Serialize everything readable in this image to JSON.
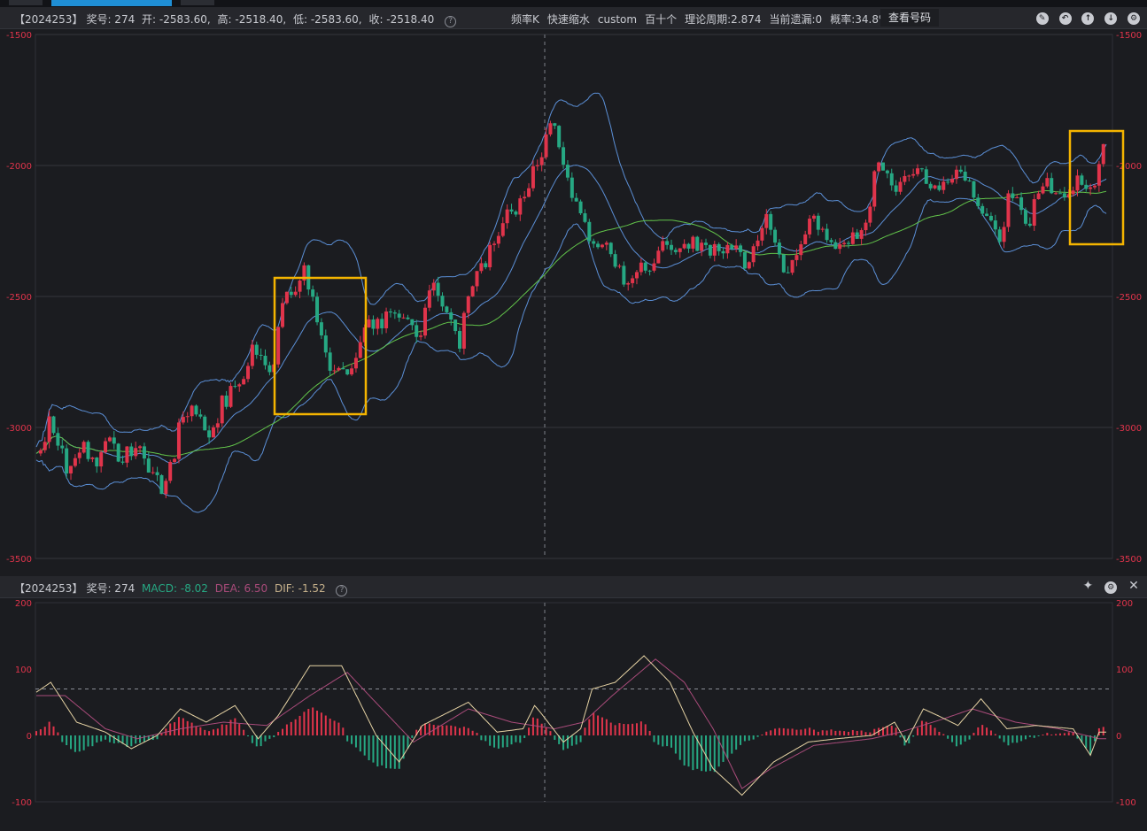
{
  "window": {
    "tabs": [
      "",
      "",
      ""
    ]
  },
  "main_header": {
    "issue": "【2024253】",
    "award_label": "奖号: 274",
    "open_text": "开: -2583.60,",
    "high_text": "高: -2518.40,",
    "low_text": "低: -2583.60,",
    "close_text": "收: -2518.40",
    "items": [
      "频率K",
      "快速缩水",
      "custom",
      "百十个",
      "理论周期:2.874",
      "当前遗漏:0",
      "概率:34.8%"
    ],
    "check_button": "查看号码",
    "icons": [
      "pencil-icon",
      "undo-icon",
      "arrow-up-icon",
      "arrow-down-icon",
      "settings-icon"
    ]
  },
  "sub_header": {
    "issue": "【2024253】",
    "award_label": "奖号: 274",
    "macd_text": "MACD: -8.02",
    "dea_text": "DEA: 6.50",
    "dif_text": "DIF: -1.52",
    "icons": [
      "pin-icon",
      "settings-icon",
      "close-icon"
    ]
  },
  "colors": {
    "up": "#e0344b",
    "down": "#26a883",
    "band": "#5b8fd6",
    "ma": "#62c44a",
    "highlight": "#f4b400",
    "dif": "#e6d3a4",
    "dea": "#a94b7a"
  },
  "chart_data": [
    {
      "type": "candlestick",
      "title": "",
      "y_axis_labels": [
        "-1500",
        "-2000",
        "-2500",
        "-3000",
        "-3500"
      ],
      "ylim": [
        -3500,
        -1500
      ],
      "last_bar": {
        "open": -2583.6,
        "high": -2518.4,
        "low": -2583.6,
        "close": -2518.4
      },
      "series": [
        {
          "name": "",
          "close_anchors": [
            [
              0,
              -3100
            ],
            [
              10,
              -2980
            ],
            [
              22,
              -3180
            ],
            [
              34,
              -3080
            ],
            [
              40,
              -3150
            ],
            [
              48,
              -3050
            ],
            [
              58,
              -3120
            ],
            [
              70,
              -3060
            ],
            [
              78,
              -3170
            ],
            [
              86,
              -3230
            ],
            [
              94,
              -3150
            ],
            [
              100,
              -2960
            ],
            [
              110,
              -2920
            ],
            [
              118,
              -3050
            ],
            [
              130,
              -2900
            ],
            [
              142,
              -2820
            ],
            [
              152,
              -2680
            ],
            [
              164,
              -2820
            ],
            [
              170,
              -2530
            ],
            [
              178,
              -2490
            ],
            [
              186,
              -2380
            ],
            [
              196,
              -2640
            ],
            [
              204,
              -2780
            ],
            [
              216,
              -2800
            ],
            [
              228,
              -2600
            ],
            [
              238,
              -2590
            ],
            [
              246,
              -2590
            ],
            [
              256,
              -2600
            ],
            [
              266,
              -2640
            ],
            [
              276,
              -2450
            ],
            [
              284,
              -2570
            ],
            [
              294,
              -2680
            ],
            [
              300,
              -2500
            ],
            [
              306,
              -2430
            ],
            [
              318,
              -2290
            ],
            [
              324,
              -2220
            ],
            [
              336,
              -2150
            ],
            [
              348,
              -2000
            ],
            [
              356,
              -1840
            ],
            [
              362,
              -1900
            ],
            [
              372,
              -2110
            ],
            [
              386,
              -2280
            ],
            [
              398,
              -2310
            ],
            [
              408,
              -2450
            ],
            [
              418,
              -2390
            ],
            [
              426,
              -2430
            ],
            [
              432,
              -2320
            ],
            [
              440,
              -2280
            ],
            [
              446,
              -2330
            ],
            [
              456,
              -2300
            ],
            [
              466,
              -2310
            ],
            [
              476,
              -2330
            ],
            [
              486,
              -2330
            ],
            [
              494,
              -2390
            ],
            [
              506,
              -2180
            ],
            [
              520,
              -2450
            ],
            [
              530,
              -2280
            ],
            [
              542,
              -2200
            ],
            [
              552,
              -2320
            ],
            [
              564,
              -2270
            ],
            [
              572,
              -2280
            ],
            [
              584,
              -2010
            ],
            [
              600,
              -2080
            ],
            [
              612,
              -2010
            ],
            [
              620,
              -2080
            ],
            [
              634,
              -2040
            ],
            [
              642,
              -2010
            ],
            [
              650,
              -2100
            ],
            [
              660,
              -2180
            ],
            [
              670,
              -2270
            ],
            [
              676,
              -2100
            ],
            [
              688,
              -2230
            ],
            [
              698,
              -2060
            ],
            [
              716,
              -2100
            ],
            [
              724,
              -2030
            ],
            [
              732,
              -2110
            ],
            [
              740,
              -1950
            ]
          ]
        },
        {
          "name": "",
          "type": "band_upper"
        },
        {
          "name": "",
          "type": "band_middle"
        },
        {
          "name": "",
          "type": "band_lower"
        },
        {
          "name": "",
          "type": "moving_average"
        }
      ],
      "highlight_boxes": 2
    },
    {
      "type": "macd",
      "title": "",
      "y_axis_labels": [
        "200",
        "100",
        "0",
        "-100"
      ],
      "ylim": [
        -100,
        200
      ],
      "reference_line": 70,
      "series": [
        {
          "name": "DIF",
          "anchors": [
            [
              0,
              65
            ],
            [
              10,
              80
            ],
            [
              28,
              20
            ],
            [
              48,
              5
            ],
            [
              66,
              -20
            ],
            [
              84,
              0
            ],
            [
              100,
              40
            ],
            [
              118,
              20
            ],
            [
              138,
              45
            ],
            [
              154,
              -5
            ],
            [
              168,
              30
            ],
            [
              190,
              105
            ],
            [
              212,
              105
            ],
            [
              236,
              0
            ],
            [
              252,
              -40
            ],
            [
              268,
              15
            ],
            [
              300,
              50
            ],
            [
              320,
              5
            ],
            [
              338,
              10
            ],
            [
              346,
              45
            ],
            [
              350,
              35
            ],
            [
              366,
              -10
            ],
            [
              378,
              10
            ],
            [
              386,
              70
            ],
            [
              402,
              80
            ],
            [
              422,
              120
            ],
            [
              440,
              80
            ],
            [
              456,
              5
            ],
            [
              470,
              -50
            ],
            [
              490,
              -90
            ],
            [
              512,
              -40
            ],
            [
              536,
              -10
            ],
            [
              556,
              -5
            ],
            [
              580,
              0
            ],
            [
              596,
              20
            ],
            [
              604,
              -10
            ],
            [
              616,
              40
            ],
            [
              626,
              30
            ],
            [
              640,
              15
            ],
            [
              656,
              55
            ],
            [
              674,
              10
            ],
            [
              694,
              15
            ],
            [
              720,
              10
            ],
            [
              732,
              -30
            ],
            [
              738,
              5
            ]
          ]
        },
        {
          "name": "DEA",
          "anchors": [
            [
              0,
              60
            ],
            [
              20,
              60
            ],
            [
              48,
              10
            ],
            [
              70,
              -5
            ],
            [
              100,
              10
            ],
            [
              130,
              20
            ],
            [
              160,
              15
            ],
            [
              190,
              60
            ],
            [
              216,
              95
            ],
            [
              240,
              40
            ],
            [
              262,
              -10
            ],
            [
              300,
              40
            ],
            [
              330,
              20
            ],
            [
              360,
              10
            ],
            [
              380,
              20
            ],
            [
              400,
              60
            ],
            [
              430,
              115
            ],
            [
              450,
              80
            ],
            [
              470,
              10
            ],
            [
              490,
              -80
            ],
            [
              510,
              -50
            ],
            [
              540,
              -15
            ],
            [
              580,
              -5
            ],
            [
              600,
              5
            ],
            [
              630,
              25
            ],
            [
              650,
              40
            ],
            [
              680,
              20
            ],
            [
              710,
              10
            ],
            [
              738,
              -5
            ]
          ]
        },
        {
          "name": "MACD",
          "type": "histogram"
        }
      ]
    }
  ]
}
